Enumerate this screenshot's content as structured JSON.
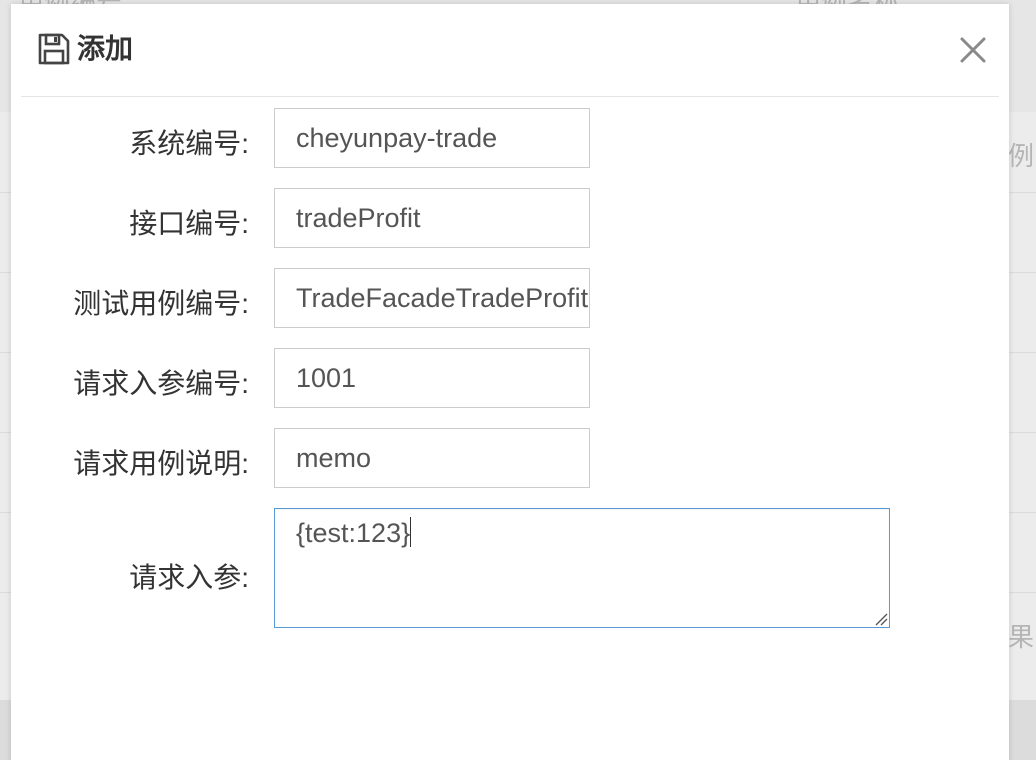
{
  "modal": {
    "title": "添加",
    "title_icon": "save-icon",
    "close_icon": "close-icon"
  },
  "form": {
    "fields": [
      {
        "label": "系统编号:",
        "value": "cheyunpay-trade"
      },
      {
        "label": "接口编号:",
        "value": "tradeProfit"
      },
      {
        "label": "测试用例编号:",
        "value": "TradeFacadeTradeProfit"
      },
      {
        "label": "请求入参编号:",
        "value": "1001"
      },
      {
        "label": "请求用例说明:",
        "value": "memo"
      }
    ],
    "params": {
      "label": "请求入参:",
      "value": "{test:123}"
    }
  },
  "background": {
    "fragments": [
      "用例编号",
      "用例名称",
      "例",
      "果"
    ]
  },
  "colors": {
    "focus_border": "#5b9bd5",
    "input_border": "#cccccc",
    "label_text": "#333333"
  }
}
